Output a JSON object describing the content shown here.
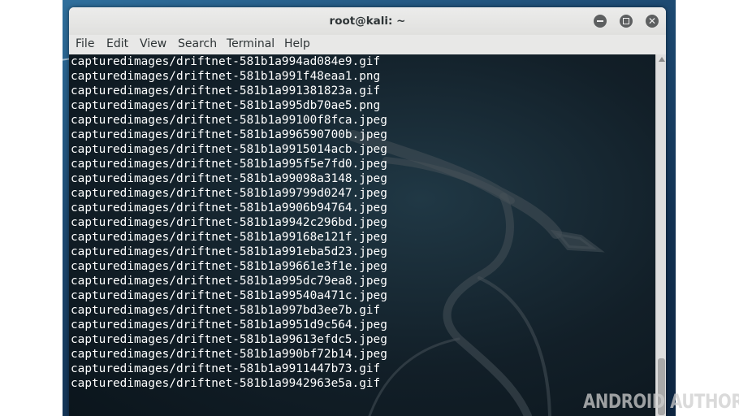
{
  "window": {
    "title": "root@kali: ~",
    "controls": [
      "minimize-icon",
      "maximize-icon",
      "close-icon"
    ]
  },
  "menubar": {
    "items": [
      "File",
      "Edit",
      "View",
      "Search",
      "Terminal",
      "Help"
    ]
  },
  "terminal": {
    "lines": [
      "capturedimages/driftnet-581b1a994ad084e9.gif",
      "capturedimages/driftnet-581b1a991f48eaa1.png",
      "capturedimages/driftnet-581b1a991381823a.gif",
      "capturedimages/driftnet-581b1a995db70ae5.png",
      "capturedimages/driftnet-581b1a99100f8fca.jpeg",
      "capturedimages/driftnet-581b1a996590700b.jpeg",
      "capturedimages/driftnet-581b1a9915014acb.jpeg",
      "capturedimages/driftnet-581b1a995f5e7fd0.jpeg",
      "capturedimages/driftnet-581b1a99098a3148.jpeg",
      "capturedimages/driftnet-581b1a99799d0247.jpeg",
      "capturedimages/driftnet-581b1a9906b94764.jpeg",
      "capturedimages/driftnet-581b1a9942c296bd.jpeg",
      "capturedimages/driftnet-581b1a99168e121f.jpeg",
      "capturedimages/driftnet-581b1a991eba5d23.jpeg",
      "capturedimages/driftnet-581b1a99661e3f1e.jpeg",
      "capturedimages/driftnet-581b1a995dc79ea8.jpeg",
      "capturedimages/driftnet-581b1a99540a471c.jpeg",
      "capturedimages/driftnet-581b1a997bd3ee7b.gif",
      "capturedimages/driftnet-581b1a9951d9c564.jpeg",
      "capturedimages/driftnet-581b1a99613efdc5.jpeg",
      "capturedimages/driftnet-581b1a990bf72b14.jpeg",
      "capturedimages/driftnet-581b1a9911447b73.gif",
      "capturedimages/driftnet-581b1a9942963e5a.gif"
    ]
  },
  "watermark": "ANDROID AUTHORITY",
  "colors": {
    "terminal_bg": "#121f28",
    "text": "#ffffff",
    "titlebar": "#e8e8e7",
    "desktop": "#1d4a72"
  }
}
